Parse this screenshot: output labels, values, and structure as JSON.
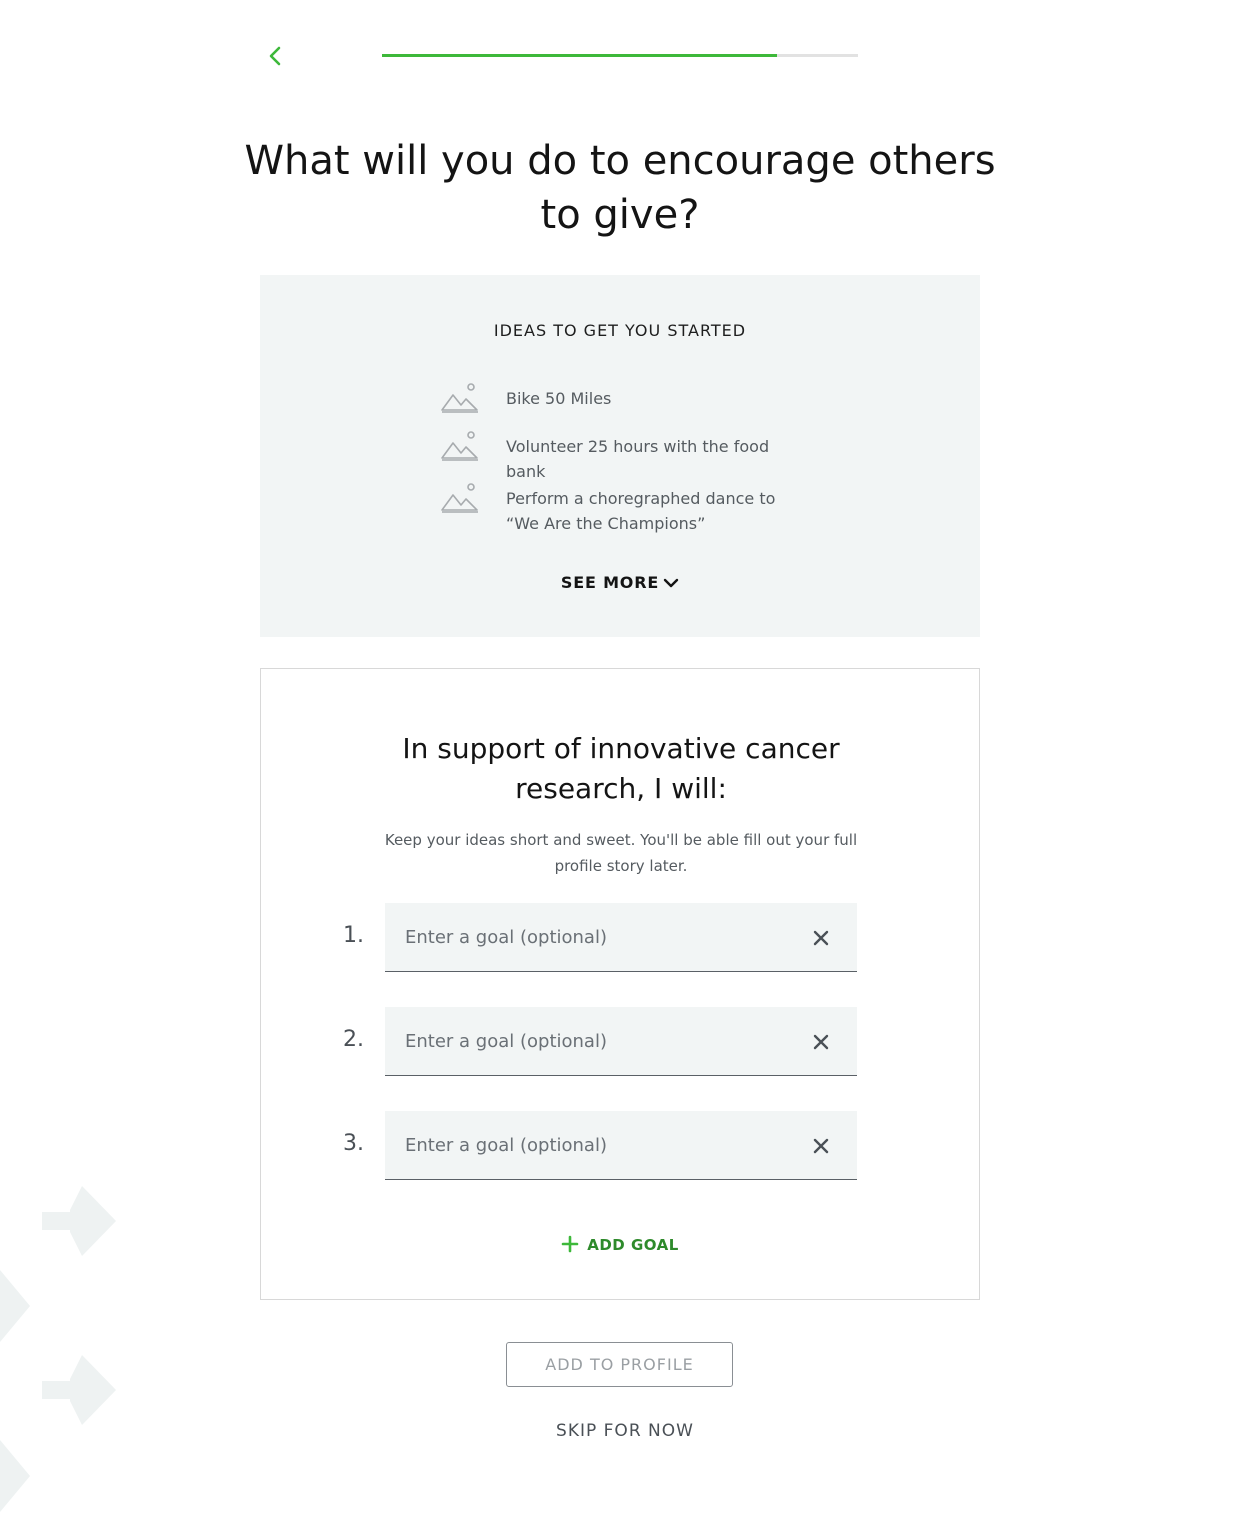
{
  "header": {
    "back_icon": "chevron-left-icon",
    "progress_fraction": 0.83,
    "accent_color": "#3db83a"
  },
  "page_title": "What will you do to encourage others to give?",
  "ideas": {
    "heading": "IDEAS TO GET YOU STARTED",
    "items": [
      {
        "icon": "image-placeholder-icon",
        "text": "Bike 50 Miles"
      },
      {
        "icon": "image-placeholder-icon",
        "text": "Volunteer 25 hours with the food bank"
      },
      {
        "icon": "image-placeholder-icon",
        "text": "Perform a choregraphed dance to “We Are the Champions”"
      }
    ],
    "see_more": "SEE MORE"
  },
  "goal_card": {
    "title": "In support of innovative cancer research, I will:",
    "help_text": "Keep your ideas short and sweet. You'll be able fill out your full profile story later.",
    "goals": [
      {
        "number": "1.",
        "placeholder": "Enter a goal (optional)",
        "value": ""
      },
      {
        "number": "2.",
        "placeholder": "Enter a goal (optional)",
        "value": ""
      },
      {
        "number": "3.",
        "placeholder": "Enter a goal (optional)",
        "value": ""
      }
    ],
    "add_goal": "ADD GOAL"
  },
  "actions": {
    "add_to_profile": "ADD TO PROFILE",
    "skip": "SKIP FOR NOW"
  }
}
